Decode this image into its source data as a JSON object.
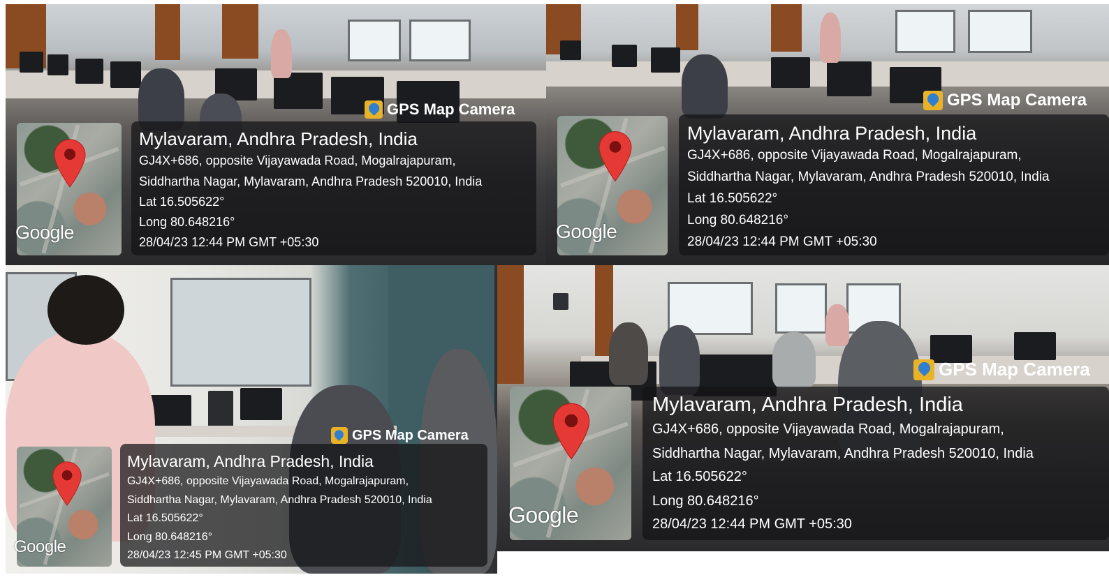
{
  "app_badge": "GPS Map Camera",
  "map_watermark": "Google",
  "colors": {
    "pin": "#e53935",
    "overlay": "#141416",
    "badge_icon": "#e9b227"
  },
  "icons": [
    "map-pin-icon",
    "gps-map-camera-icon"
  ],
  "photos": [
    {
      "location": "Mylavaram, Andhra Pradesh, India",
      "address_line1": "GJ4X+686, opposite Vijayawada Road, Mogalrajapuram,",
      "address_line2": "Siddhartha Nagar, Mylavaram, Andhra Pradesh 520010, India",
      "lat": "Lat 16.505622°",
      "long": "Long 80.648216°",
      "datetime": "28/04/23 12:44 PM GMT +05:30"
    },
    {
      "location": "Mylavaram, Andhra Pradesh, India",
      "address_line1": "GJ4X+686, opposite Vijayawada Road, Mogalrajapuram,",
      "address_line2": "Siddhartha Nagar, Mylavaram, Andhra Pradesh 520010, India",
      "lat": "Lat 16.505622°",
      "long": "Long 80.648216°",
      "datetime": "28/04/23 12:44 PM GMT +05:30"
    },
    {
      "location": "Mylavaram, Andhra Pradesh, India",
      "address_line1": "GJ4X+686, opposite Vijayawada Road, Mogalrajapuram,",
      "address_line2": "Siddhartha Nagar, Mylavaram, Andhra Pradesh 520010, India",
      "lat": "Lat 16.505622°",
      "long": "Long 80.648216°",
      "datetime": "28/04/23 12:45 PM GMT +05:30"
    },
    {
      "location": "Mylavaram, Andhra Pradesh, India",
      "address_line1": "GJ4X+686, opposite Vijayawada Road, Mogalrajapuram,",
      "address_line2": "Siddhartha Nagar, Mylavaram, Andhra Pradesh 520010, India",
      "lat": "Lat 16.505622°",
      "long": "Long 80.648216°",
      "datetime": "28/04/23 12:44 PM GMT +05:30"
    }
  ]
}
